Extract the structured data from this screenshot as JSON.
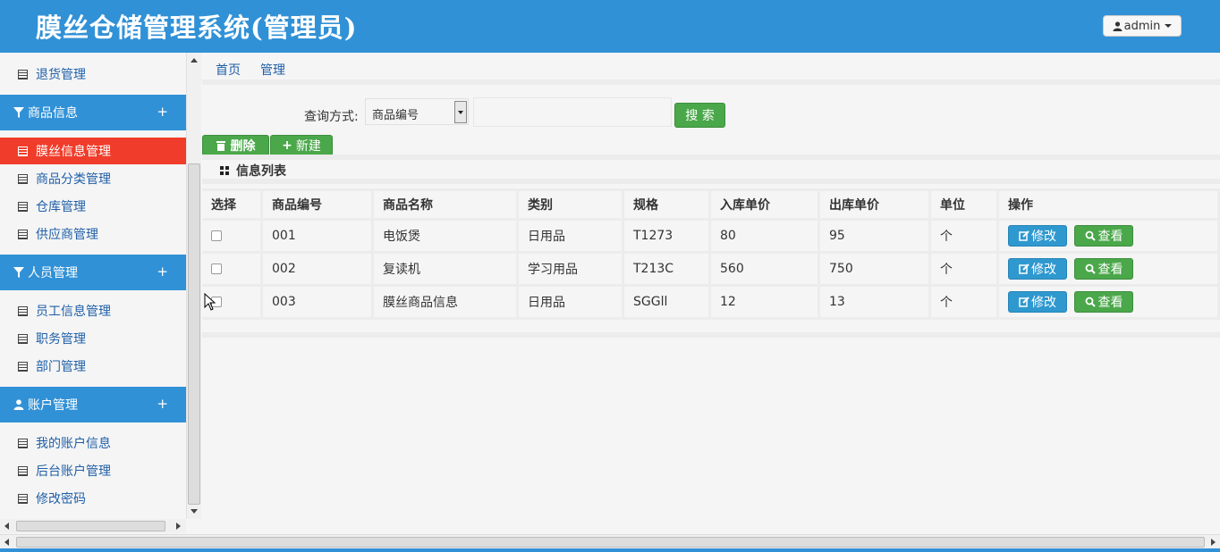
{
  "header": {
    "title": "膜丝仓储管理系统(管理员)",
    "user_label": "admin"
  },
  "sidebar": {
    "items_top": [
      {
        "label": "退货管理"
      }
    ],
    "groups": [
      {
        "label": "商品信息",
        "icon": "filter-icon",
        "items": [
          {
            "label": "膜丝信息管理",
            "active": true
          },
          {
            "label": "商品分类管理"
          },
          {
            "label": "仓库管理"
          },
          {
            "label": "供应商管理"
          }
        ]
      },
      {
        "label": "人员管理",
        "icon": "filter-icon",
        "items": [
          {
            "label": "员工信息管理"
          },
          {
            "label": "职务管理"
          },
          {
            "label": "部门管理"
          }
        ]
      },
      {
        "label": "账户管理",
        "icon": "user-icon",
        "items": [
          {
            "label": "我的账户信息"
          },
          {
            "label": "后台账户管理"
          },
          {
            "label": "修改密码"
          }
        ]
      }
    ],
    "expand_symbol": "+"
  },
  "breadcrumb": [
    "首页",
    "管理"
  ],
  "search": {
    "label": "查询方式:",
    "selected": "商品编号",
    "value": "",
    "button": "搜 索"
  },
  "toolbar": {
    "delete_label": "删除",
    "new_label": "新建"
  },
  "list": {
    "title": "信息列表",
    "columns": [
      "选择",
      "商品编号",
      "商品名称",
      "类别",
      "规格",
      "入库单价",
      "出库单价",
      "单位",
      "操作"
    ],
    "rows": [
      [
        "001",
        "电饭煲",
        "日用品",
        "T1273",
        "80",
        "95",
        "个"
      ],
      [
        "002",
        "复读机",
        "学习用品",
        "T213C",
        "560",
        "750",
        "个"
      ],
      [
        "003",
        "膜丝商品信息",
        "日用品",
        "SGGll",
        "12",
        "13",
        "个"
      ]
    ],
    "edit_label": "修改",
    "view_label": "查看"
  },
  "colors": {
    "header": "#3191d6",
    "active": "#f03c2a",
    "green": "#4aa74a",
    "blue": "#2f98cf"
  }
}
